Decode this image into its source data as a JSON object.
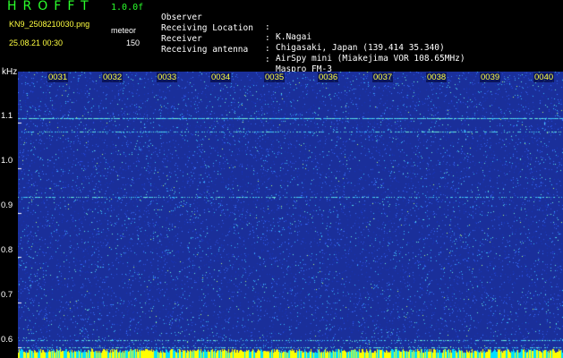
{
  "header": {
    "app_title": "HROFFT",
    "version": "1.0.0f",
    "filename": "KN9_2508210030.png",
    "mode": "meteor",
    "datetime": "25.08.21 00:30",
    "count": "150"
  },
  "info": [
    {
      "key": "Observer",
      "sep": ":",
      "value": "K.Nagai"
    },
    {
      "key": "Receiving Location",
      "sep": ":",
      "value": "Chigasaki, Japan (139.414 35.340)"
    },
    {
      "key": "Receiver",
      "sep": ":",
      "value": "AirSpy mini (Miakejima VOR 108.65MHz)"
    },
    {
      "key": "Receiving antenna",
      "sep": ":",
      "value": "Maspro FM-3"
    }
  ],
  "spectrogram": {
    "y_unit": "kHz",
    "y_ticks": [
      "1.1",
      "1.0",
      "0.9",
      "0.8",
      "0.7",
      "0.6"
    ],
    "y_tick_values": [
      1.1,
      1.0,
      0.9,
      0.8,
      0.7,
      0.6
    ],
    "y_range": [
      0.575,
      1.215
    ],
    "x_ticks": [
      "0031",
      "0032",
      "0033",
      "0034",
      "0035",
      "0036",
      "0037",
      "0038",
      "0039",
      "0040"
    ],
    "background_color": "#1a2f9a",
    "speckle_colors": [
      "#1632b8",
      "#2a4fe0",
      "#3a74ff",
      "#38c0ff",
      "#6cf0d8",
      "#b6ff7a"
    ],
    "baseline_colors": [
      "#ffff00",
      "#00e0ff"
    ],
    "signal_lines_khz": [
      1.11,
      1.08,
      0.935,
      0.615,
      0.6
    ]
  }
}
